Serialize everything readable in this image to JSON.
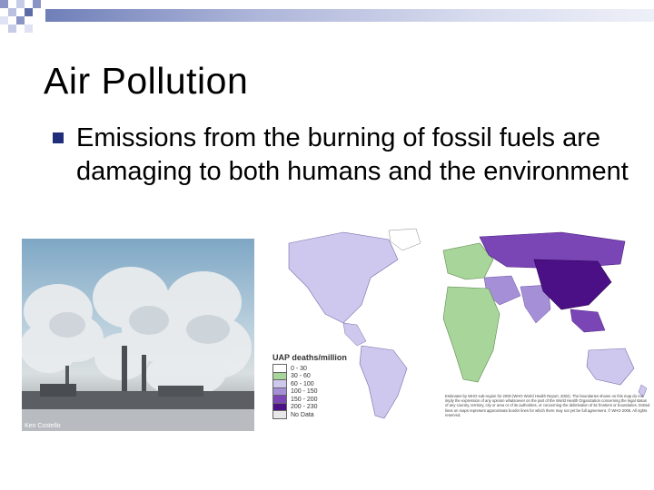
{
  "slide": {
    "title": "Air Pollution",
    "bullet_text": "Emissions from the burning of fossil fuels are damaging to both humans and the environment"
  },
  "photo": {
    "credit": "Ken Costello"
  },
  "map": {
    "legend_title": "UAP deaths/million",
    "legend": [
      {
        "label": "0 - 30",
        "color": "#ffffff"
      },
      {
        "label": "30 - 60",
        "color": "#a8d59a"
      },
      {
        "label": "60 - 100",
        "color": "#cfc8ee"
      },
      {
        "label": "100 - 150",
        "color": "#a58fd6"
      },
      {
        "label": "150 - 200",
        "color": "#7a45b5"
      },
      {
        "label": "200 - 230",
        "color": "#4b0f86"
      },
      {
        "label": "No Data",
        "color": "#e8e8e8"
      }
    ],
    "note": "Estimates by WHO sub-region for 2000 (WHO World Health Report, 2002). The boundaries shown on this map do not imply the expression of any opinion whatsoever on the part of the World Health Organization concerning the legal status of any country, territory, city or area or of its authorities, or concerning the delimitation of its frontiers or boundaries. Dotted lines on maps represent approximate border lines for which there may not yet be full agreement. © WHO 2005. All rights reserved."
  },
  "colors": {
    "bullet": "#1f2d7a",
    "header_bar_start": "#6f7fb8"
  }
}
